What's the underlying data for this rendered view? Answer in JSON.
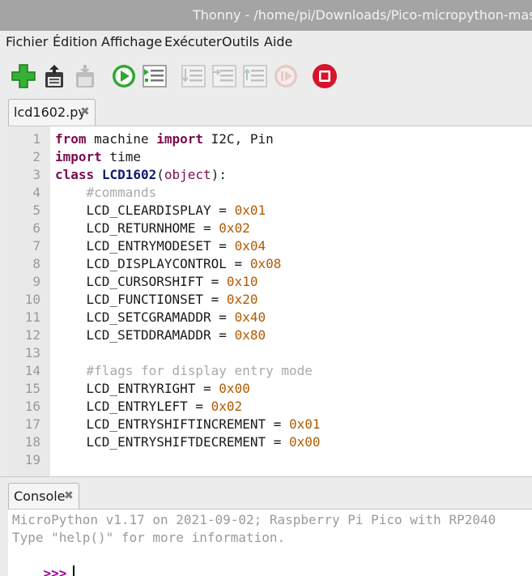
{
  "window": {
    "title": "Thonny  -  /home/pi/Downloads/Pico-micropython-master/L"
  },
  "menu": {
    "items": [
      "Fichier",
      "Édition",
      "Affichage",
      "Exécuter",
      "Outils",
      "Aide"
    ]
  },
  "toolbar": {
    "buttons": [
      {
        "name": "new-file",
        "icon": "plus-icon",
        "enabled": true
      },
      {
        "name": "open-file",
        "icon": "folder-open-icon",
        "enabled": true
      },
      {
        "name": "save-file",
        "icon": "save-icon",
        "enabled": false
      },
      {
        "name": "run",
        "icon": "play-icon",
        "enabled": true
      },
      {
        "name": "debug",
        "icon": "debug-icon",
        "enabled": true
      },
      {
        "name": "step-over",
        "icon": "step-over-icon",
        "enabled": false
      },
      {
        "name": "step-into",
        "icon": "step-into-icon",
        "enabled": false
      },
      {
        "name": "step-out",
        "icon": "step-out-icon",
        "enabled": false
      },
      {
        "name": "resume",
        "icon": "resume-icon",
        "enabled": false
      },
      {
        "name": "stop",
        "icon": "stop-icon",
        "enabled": true
      }
    ],
    "colors": {
      "green": "#2fa82f",
      "red": "#d4152b",
      "disabled": "#bdbdbd"
    }
  },
  "editor": {
    "tab": {
      "label": "lcd1602.py",
      "close": "✖"
    },
    "lines": [
      {
        "n": "1",
        "tokens": [
          {
            "t": "from",
            "c": "kw"
          },
          {
            "t": " machine ",
            "c": ""
          },
          {
            "t": "import",
            "c": "kw"
          },
          {
            "t": " I2C, Pin",
            "c": ""
          }
        ]
      },
      {
        "n": "2",
        "tokens": [
          {
            "t": "import",
            "c": "kw"
          },
          {
            "t": " time",
            "c": ""
          }
        ]
      },
      {
        "n": "3",
        "tokens": [
          {
            "t": "class",
            "c": "kw"
          },
          {
            "t": " ",
            "c": ""
          },
          {
            "t": "LCD1602",
            "c": "cls"
          },
          {
            "t": "(",
            "c": ""
          },
          {
            "t": "object",
            "c": "bi"
          },
          {
            "t": "):",
            "c": ""
          }
        ]
      },
      {
        "n": "4",
        "tokens": [
          {
            "t": "    ",
            "c": ""
          },
          {
            "t": "#commands",
            "c": "cmt"
          }
        ]
      },
      {
        "n": "5",
        "tokens": [
          {
            "t": "    LCD_CLEARDISPLAY = ",
            "c": ""
          },
          {
            "t": "0x01",
            "c": "num"
          }
        ]
      },
      {
        "n": "6",
        "tokens": [
          {
            "t": "    LCD_RETURNHOME = ",
            "c": ""
          },
          {
            "t": "0x02",
            "c": "num"
          }
        ]
      },
      {
        "n": "7",
        "tokens": [
          {
            "t": "    LCD_ENTRYMODESET = ",
            "c": ""
          },
          {
            "t": "0x04",
            "c": "num"
          }
        ]
      },
      {
        "n": "8",
        "tokens": [
          {
            "t": "    LCD_DISPLAYCONTROL = ",
            "c": ""
          },
          {
            "t": "0x08",
            "c": "num"
          }
        ]
      },
      {
        "n": "9",
        "tokens": [
          {
            "t": "    LCD_CURSORSHIFT = ",
            "c": ""
          },
          {
            "t": "0x10",
            "c": "num"
          }
        ]
      },
      {
        "n": "10",
        "tokens": [
          {
            "t": "    LCD_FUNCTIONSET = ",
            "c": ""
          },
          {
            "t": "0x20",
            "c": "num"
          }
        ]
      },
      {
        "n": "11",
        "tokens": [
          {
            "t": "    LCD_SETCGRAMADDR = ",
            "c": ""
          },
          {
            "t": "0x40",
            "c": "num"
          }
        ]
      },
      {
        "n": "12",
        "tokens": [
          {
            "t": "    LCD_SETDDRAMADDR = ",
            "c": ""
          },
          {
            "t": "0x80",
            "c": "num"
          }
        ]
      },
      {
        "n": "13",
        "tokens": []
      },
      {
        "n": "14",
        "tokens": [
          {
            "t": "    ",
            "c": ""
          },
          {
            "t": "#flags for display entry mode",
            "c": "cmt"
          }
        ]
      },
      {
        "n": "15",
        "tokens": [
          {
            "t": "    LCD_ENTRYRIGHT = ",
            "c": ""
          },
          {
            "t": "0x00",
            "c": "num"
          }
        ]
      },
      {
        "n": "16",
        "tokens": [
          {
            "t": "    LCD_ENTRYLEFT = ",
            "c": ""
          },
          {
            "t": "0x02",
            "c": "num"
          }
        ]
      },
      {
        "n": "17",
        "tokens": [
          {
            "t": "    LCD_ENTRYSHIFTINCREMENT = ",
            "c": ""
          },
          {
            "t": "0x01",
            "c": "num"
          }
        ]
      },
      {
        "n": "18",
        "tokens": [
          {
            "t": "    LCD_ENTRYSHIFTDECREMENT = ",
            "c": ""
          },
          {
            "t": "0x00",
            "c": "num"
          }
        ]
      },
      {
        "n": "19",
        "tokens": []
      }
    ]
  },
  "console": {
    "tab": {
      "label": "Console",
      "close": "✖"
    },
    "banner": "MicroPython v1.17 on 2021-09-02; Raspberry Pi Pico with RP2040",
    "help": "Type \"help()\" for more information.",
    "prompt": ">>>"
  }
}
